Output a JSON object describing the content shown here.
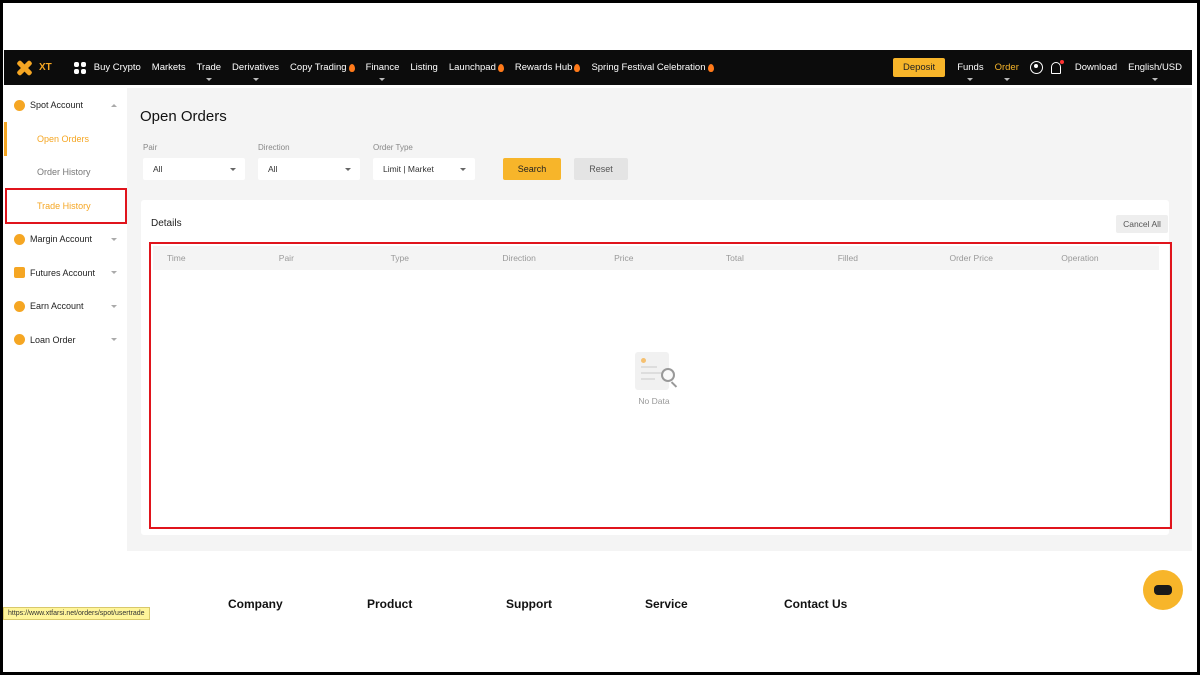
{
  "topnav": {
    "logo_text": "XT",
    "items": [
      {
        "label": "Buy Crypto",
        "caret": false,
        "hot": false
      },
      {
        "label": "Markets",
        "caret": false,
        "hot": false
      },
      {
        "label": "Trade",
        "caret": true,
        "hot": false
      },
      {
        "label": "Derivatives",
        "caret": true,
        "hot": false
      },
      {
        "label": "Copy Trading",
        "caret": false,
        "hot": true
      },
      {
        "label": "Finance",
        "caret": true,
        "hot": false
      },
      {
        "label": "Listing",
        "caret": false,
        "hot": false
      },
      {
        "label": "Launchpad",
        "caret": false,
        "hot": true
      },
      {
        "label": "Rewards Hub",
        "caret": false,
        "hot": true
      },
      {
        "label": "Spring Festival Celebration",
        "caret": false,
        "hot": true
      }
    ],
    "deposit_label": "Deposit",
    "funds_label": "Funds",
    "order_label": "Order",
    "download_label": "Download",
    "language_label": "English/USD",
    "accent_color": "#f7b52a"
  },
  "sidebar": {
    "spot_account": "Spot Account",
    "open_orders": "Open Orders",
    "order_history": "Order History",
    "trade_history": "Trade History",
    "margin_account": "Margin Account",
    "futures_account": "Futures Account",
    "earn_account": "Earn Account",
    "loan_order": "Loan Order"
  },
  "main": {
    "title": "Open Orders",
    "filters": {
      "pair_label": "Pair",
      "pair_value": "All",
      "direction_label": "Direction",
      "direction_value": "All",
      "order_type_label": "Order Type",
      "order_type_value": "Limit | Market"
    },
    "search_label": "Search",
    "reset_label": "Reset",
    "details_title": "Details",
    "cancel_all_label": "Cancel All",
    "columns": [
      "Time",
      "Pair",
      "Type",
      "Direction",
      "Price",
      "Total",
      "Filled",
      "Order Price",
      "Operation"
    ],
    "empty_text": "No Data"
  },
  "footer": {
    "columns": [
      "Company",
      "Product",
      "Support",
      "Service",
      "Contact Us"
    ]
  },
  "status_url": "https://www.xtfarsi.net/orders/spot/usertrade"
}
